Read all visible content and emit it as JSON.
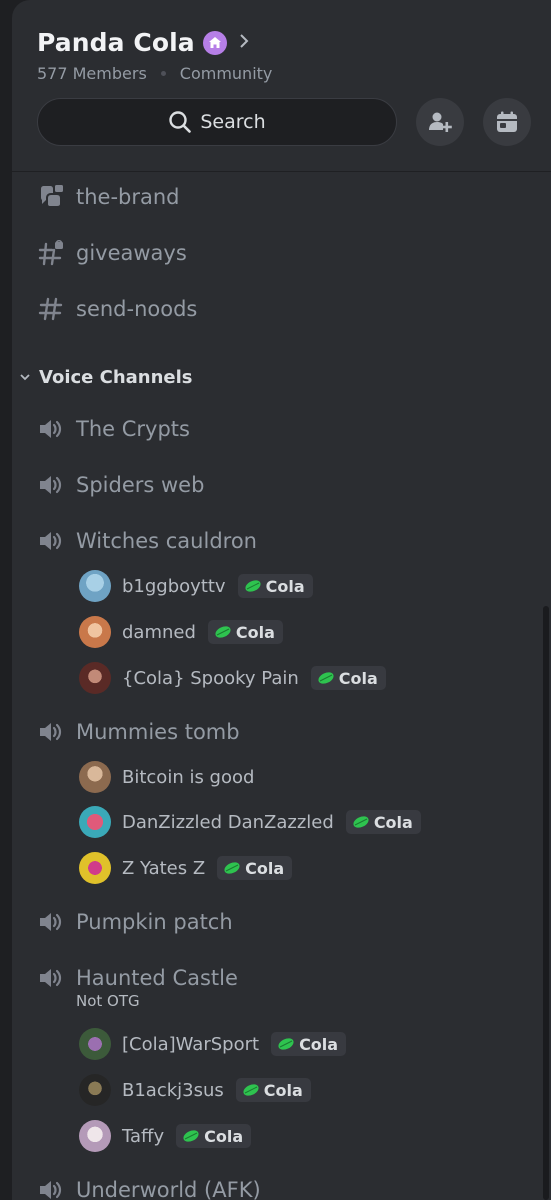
{
  "server": {
    "name": "Panda Cola",
    "members": "577 Members",
    "type": "Community",
    "search_label": "Search"
  },
  "channels": [
    {
      "name": "the-brand",
      "icon": "locked-rules-icon"
    },
    {
      "name": "giveaways",
      "icon": "locked-hash-icon"
    },
    {
      "name": "send-noods",
      "icon": "hash-icon"
    }
  ],
  "voice_category": "Voice Channels",
  "voice_channels": [
    {
      "name": "The Crypts",
      "users": []
    },
    {
      "name": "Spiders web",
      "users": []
    },
    {
      "name": "Witches cauldron",
      "users": [
        {
          "name": "b1ggboyttv",
          "tag": "Cola",
          "avatar_color": "#6fa3c4"
        },
        {
          "name": "damned",
          "tag": "Cola",
          "avatar_color": "#c9784a"
        },
        {
          "name": "{Cola} Spooky Pain",
          "tag": "Cola",
          "avatar_color": "#7a3b33"
        }
      ]
    },
    {
      "name": "Mummies tomb",
      "users": [
        {
          "name": "Bitcoin is good",
          "tag": "",
          "avatar_color": "#8c6a4f"
        },
        {
          "name": "DanZizzled DanZazzled",
          "tag": "Cola",
          "avatar_color": "#3aa9b8"
        },
        {
          "name": "Z Yates Z",
          "tag": "Cola",
          "avatar_color": "#e0c12a"
        }
      ]
    },
    {
      "name": "Pumpkin patch",
      "users": []
    },
    {
      "name": "Haunted Castle",
      "status": "Not OTG",
      "users": [
        {
          "name": "[Cola]WarSport",
          "tag": "Cola",
          "avatar_color": "#5c4a7a"
        },
        {
          "name": "B1ackj3sus",
          "tag": "Cola",
          "avatar_color": "#3a3a3a"
        },
        {
          "name": "Taffy",
          "tag": "Cola",
          "avatar_color": "#c8b8c8"
        }
      ]
    },
    {
      "name": "Underworld (AFK)",
      "users": []
    }
  ],
  "colors": {
    "background": "#2b2d31",
    "tag_leaf": "#23a559",
    "muted_text": "#949ba4",
    "badge": "#b67fe7"
  }
}
